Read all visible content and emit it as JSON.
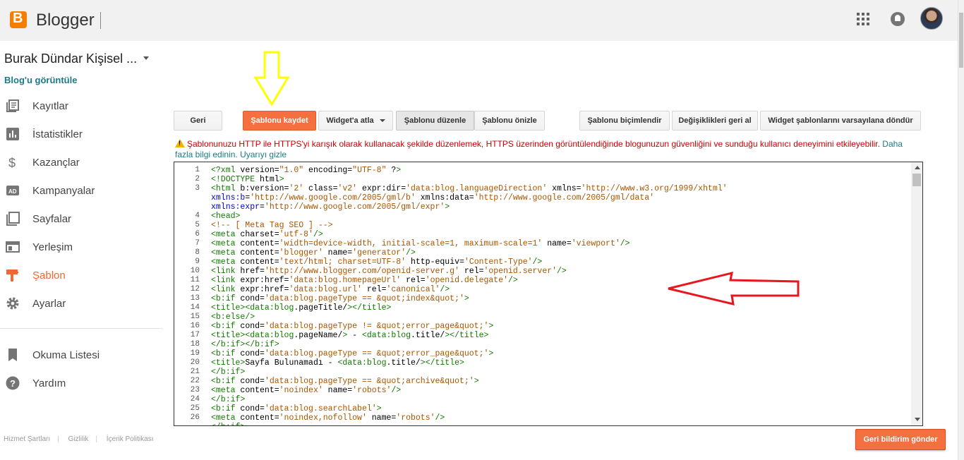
{
  "header": {
    "brand": "Blogger",
    "logo_letter": "B",
    "apps_icon": "apps-grid-icon",
    "notifications_icon": "bell-icon"
  },
  "sidebar": {
    "blog_title": "Burak Dündar Kişisel ...",
    "view_blog": "Blog'u görüntüle",
    "items": [
      {
        "label": "Kayıtlar",
        "icon": "posts-icon"
      },
      {
        "label": "İstatistikler",
        "icon": "stats-icon"
      },
      {
        "label": "Kazançlar",
        "icon": "dollar-icon"
      },
      {
        "label": "Kampanyalar",
        "icon": "ad-icon"
      },
      {
        "label": "Sayfalar",
        "icon": "pages-icon"
      },
      {
        "label": "Yerleşim",
        "icon": "layout-icon"
      },
      {
        "label": "Şablon",
        "icon": "brush-icon",
        "active": true
      },
      {
        "label": "Ayarlar",
        "icon": "gear-icon"
      }
    ],
    "secondary_items": [
      {
        "label": "Okuma Listesi",
        "icon": "bookmark-icon"
      },
      {
        "label": "Yardım",
        "icon": "help-icon"
      }
    ],
    "footer": [
      "Hizmet Şartları",
      "Gizlilik",
      "İçerik Politikası"
    ]
  },
  "toolbar": {
    "back": "Geri",
    "save": "Şablonu kaydet",
    "jump_widget": "Widget'a atla",
    "edit_template": "Şablonu düzenle",
    "preview": "Şablonu önizle",
    "format": "Şablonu biçimlendir",
    "revert": "Değişiklikleri geri al",
    "reset_widgets": "Widget şablonlarını varsayılana döndür"
  },
  "warning": {
    "text": "Şablonunuzu HTTP ile HTTPS'yi karışık olarak kullanacak şekilde düzenlemek, HTTPS üzerinden görüntülendiğinde blogunuzun güvenliğini ve sunduğu kullanıcı deneyimini etkileyebilir.",
    "learn_more": "Daha fazla bilgi edinin.",
    "hide": "Uyarıyı gizle"
  },
  "code_lines": [
    {
      "n": "1",
      "text": "<?xml version=\"1.0\" encoding=\"UTF-8\" ?>"
    },
    {
      "n": "2",
      "text": "<!DOCTYPE html>"
    },
    {
      "n": "3",
      "text": "<html b:version='2' class='v2' expr:dir='data:blog.languageDirection' xmlns='http://www.w3.org/1999/xhtml'"
    },
    {
      "n": "",
      "text": "xmlns:b='http://www.google.com/2005/gml/b' xmlns:data='http://www.google.com/2005/gml/data'"
    },
    {
      "n": "",
      "text": "xmlns:expr='http://www.google.com/2005/gml/expr'>"
    },
    {
      "n": "4",
      "text": "<head>"
    },
    {
      "n": "5",
      "text": "<!-- [ Meta Tag SEO ] -->"
    },
    {
      "n": "6",
      "text": "<meta charset='utf-8'/>"
    },
    {
      "n": "7",
      "text": "<meta content='width=device-width, initial-scale=1, maximum-scale=1' name='viewport'/>"
    },
    {
      "n": "8",
      "text": "<meta content='blogger' name='generator'/>"
    },
    {
      "n": "9",
      "text": "<meta content='text/html; charset=UTF-8' http-equiv='Content-Type'/>"
    },
    {
      "n": "10",
      "text": "<link href='http://www.blogger.com/openid-server.g' rel='openid.server'/>"
    },
    {
      "n": "11",
      "text": "<link expr:href='data:blog.homepageUrl' rel='openid.delegate'/>"
    },
    {
      "n": "12",
      "text": "<link expr:href='data:blog.url' rel='canonical'/>"
    },
    {
      "n": "13",
      "text": "<b:if cond='data:blog.pageType == &quot;index&quot;'>"
    },
    {
      "n": "14",
      "text": "<title><data:blog.pageTitle/></title>"
    },
    {
      "n": "15",
      "text": "<b:else/>"
    },
    {
      "n": "16",
      "text": "<b:if cond='data:blog.pageType != &quot;error_page&quot;'>"
    },
    {
      "n": "17",
      "text": "<title><data:blog.pageName/> - <data:blog.title/></title>"
    },
    {
      "n": "18",
      "text": "</b:if></b:if>"
    },
    {
      "n": "19",
      "text": "<b:if cond='data:blog.pageType == &quot;error_page&quot;'>"
    },
    {
      "n": "20",
      "text": "<title>Sayfa Bulunamadı - <data:blog.title/></title>"
    },
    {
      "n": "21",
      "text": "</b:if>"
    },
    {
      "n": "22",
      "text": "<b:if cond='data:blog.pageType == &quot;archive&quot;'>"
    },
    {
      "n": "23",
      "text": "<meta content='noindex' name='robots'/>"
    },
    {
      "n": "24",
      "text": "</b:if>"
    },
    {
      "n": "25",
      "text": "<b:if cond='data:blog.searchLabel'>"
    },
    {
      "n": "26",
      "text": "<meta content='noindex,nofollow' name='robots'/>"
    },
    {
      "n": "",
      "text": "</b:if>"
    }
  ],
  "feedback_button": "Geri bildirim gönder",
  "colors": {
    "accent": "#f4703e",
    "link": "#1a7b86",
    "warning_text": "#cc0000",
    "annotation_yellow": "#ffff00",
    "annotation_red": "#e8161e"
  }
}
